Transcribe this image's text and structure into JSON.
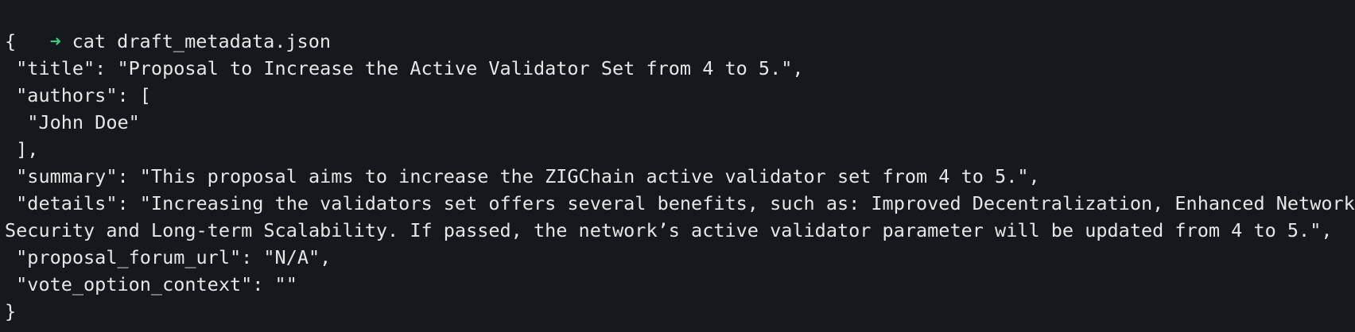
{
  "terminal": {
    "prompt": {
      "symbol": "➜",
      "command": "cat draft_metadata.json"
    },
    "lines": [
      "{",
      " \"title\": \"Proposal to Increase the Active Validator Set from 4 to 5.\",",
      " \"authors\": [",
      "  \"John Doe\"",
      " ],",
      " \"summary\": \"This proposal aims to increase the ZIGChain active validator set from 4 to 5.\",",
      " \"details\": \"Increasing the validators set offers several benefits, such as: Improved Decentralization, Enhanced Network",
      "Security and Long-term Scalability. If passed, the network’s active validator parameter will be updated from 4 to 5.\",",
      " \"proposal_forum_url\": \"N/A\",",
      " \"vote_option_context\": \"\"",
      "}"
    ],
    "colors": {
      "background": "#15191e",
      "text": "#e6e6e6",
      "prompt_accent": "#35d07f"
    }
  }
}
